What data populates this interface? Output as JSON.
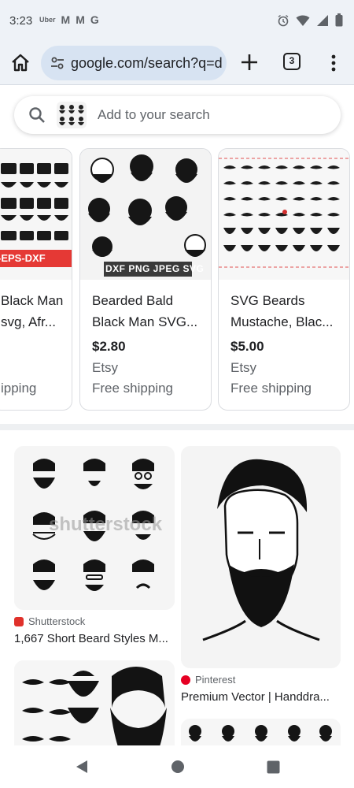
{
  "status_bar": {
    "time": "3:23",
    "apps": [
      "Uber",
      "M",
      "M",
      "G"
    ]
  },
  "browser": {
    "url": "google.com/search?q=d",
    "tab_count": "3"
  },
  "search": {
    "placeholder": "Add to your search"
  },
  "products": [
    {
      "title_line1": "Black Man",
      "title_line2": "svg, Afr...",
      "price": "",
      "store": "",
      "shipping": "ipping",
      "banner": "-EPS-DXF"
    },
    {
      "title_line1": "Bearded Bald",
      "title_line2": "Black Man SVG...",
      "price": "$2.80",
      "store": "Etsy",
      "shipping": "Free shipping",
      "banner": "DXF PNG JPEG SVG"
    },
    {
      "title_line1": "SVG Beards",
      "title_line2": "Mustache, Blac...",
      "price": "$5.00",
      "store": "Etsy",
      "shipping": "Free shipping"
    }
  ],
  "images": [
    {
      "source": "Shutterstock",
      "caption": "1,667 Short Beard Styles M...",
      "watermark": "shutterstock",
      "badge_color": "#e0312b"
    },
    {
      "source": "Pinterest",
      "caption": "Premium Vector | Handdra...",
      "badge_color": "#e60023"
    },
    {
      "source": "",
      "caption": ""
    },
    {
      "source": "",
      "caption": ""
    }
  ],
  "icons": {
    "home": "home-icon",
    "plus": "plus-icon",
    "menu": "more-vert-icon",
    "search": "search-icon",
    "nav_back": "back-triangle-icon",
    "nav_home": "home-circle-icon",
    "nav_recents": "recents-square-icon"
  }
}
